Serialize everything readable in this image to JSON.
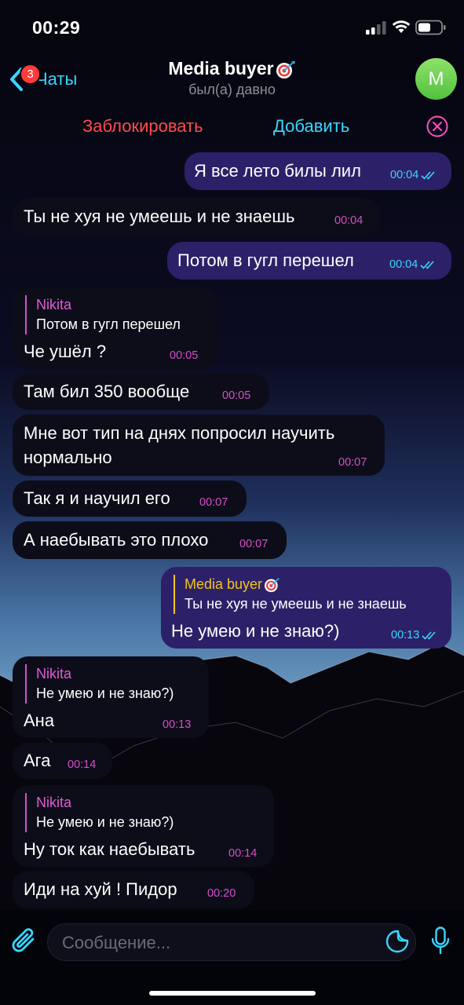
{
  "status": {
    "time": "00:29"
  },
  "header": {
    "back_label": "Чаты",
    "unread_badge": "3",
    "contact_name": "Media buyer",
    "contact_status": "был(а) давно",
    "avatar_letter": "M"
  },
  "actions": {
    "block_label": "Заблокировать",
    "add_label": "Добавить"
  },
  "messages": [
    {
      "dir": "out",
      "text": "Я все лето билы лил",
      "time": "00:04",
      "read": true
    },
    {
      "dir": "in",
      "text": "Ты не хуя не умеешь и не знаешь",
      "time": "00:04"
    },
    {
      "dir": "out",
      "text": "Потом в гугл перешел",
      "time": "00:04",
      "read": true
    },
    {
      "dir": "in",
      "reply_name": "Nikita",
      "reply_text": "Потом в гугл перешел",
      "text": "Че ушёл ?",
      "time": "00:05"
    },
    {
      "dir": "in",
      "text": "Там бил 350 вообще",
      "time": "00:05"
    },
    {
      "dir": "in",
      "text_line1": "Мне вот тип на днях попросил научить",
      "text_line2": "нормально",
      "time": "00:07"
    },
    {
      "dir": "in",
      "text": "Так я и научил его",
      "time": "00:07"
    },
    {
      "dir": "in",
      "text": "А наебывать это плохо",
      "time": "00:07"
    },
    {
      "dir": "out",
      "reply_name": "Media buyer",
      "reply_text": "Ты не хуя не умеешь и не знаешь",
      "text": "Не умею и не знаю?)",
      "time": "00:13",
      "read": true
    },
    {
      "dir": "in",
      "reply_name": "Nikita",
      "reply_text": "Не умею и не знаю?)",
      "text": "Ана",
      "time": "00:13"
    },
    {
      "dir": "in",
      "text": "Ага",
      "time": "00:14"
    },
    {
      "dir": "in",
      "reply_name": "Nikita",
      "reply_text": "Не умею и не знаю?)",
      "text": "Ну ток как наебывать",
      "time": "00:14"
    },
    {
      "dir": "in",
      "text": "Иди на хуй ! Пидор",
      "time": "00:20"
    }
  ],
  "input": {
    "placeholder": "Сообщение..."
  },
  "colors": {
    "accent": "#3ad6ff",
    "danger": "#ff4b4b",
    "incoming_bubble": "#0d0d19",
    "outgoing_bubble": "#2c2168",
    "incoming_meta": "#d44fc8",
    "reply_name_out": "#f5c518",
    "avatar": "#6bd14f"
  },
  "icons": {
    "back": "chevron-left-icon",
    "contact_emoji": "dart-target-icon",
    "close": "close-circle-icon",
    "attach": "paperclip-icon",
    "sticker": "sticker-icon",
    "mic": "microphone-icon",
    "read": "double-check-icon"
  }
}
